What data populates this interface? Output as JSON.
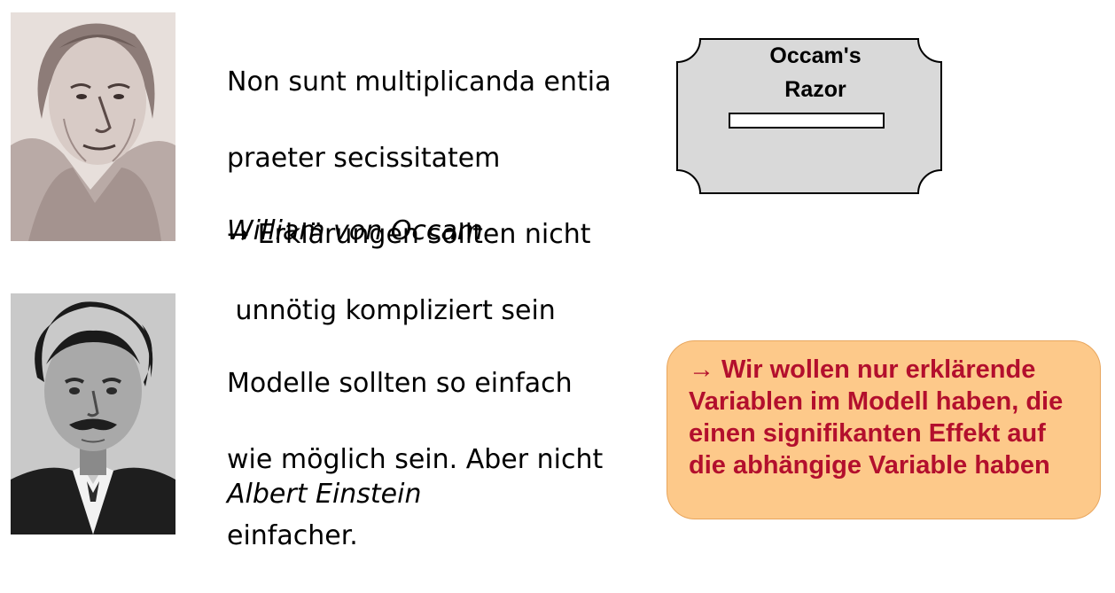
{
  "occam": {
    "quote_lines": [
      "Non sunt multiplicanda entia",
      "praeter secissitatem",
      "→  Erklärungen sollten nicht",
      " unnötig kompliziert sein"
    ],
    "author": "William von Occam"
  },
  "einstein": {
    "quote_lines": [
      "Modelle sollten so einfach",
      "wie möglich sein. Aber nicht",
      "einfacher."
    ],
    "author": "Albert Einstein"
  },
  "razor": {
    "line1": "Occam's",
    "line2": "Razor"
  },
  "conclusion": {
    "text": "→ Wir wollen nur erklärende Variablen im Modell haben, die einen signifikanten Effekt auf die abhängige Variable haben"
  },
  "colors": {
    "conclusion_bg": "#fdc98a",
    "conclusion_text": "#b30f2d",
    "razor_fill": "#d9d9d9"
  }
}
